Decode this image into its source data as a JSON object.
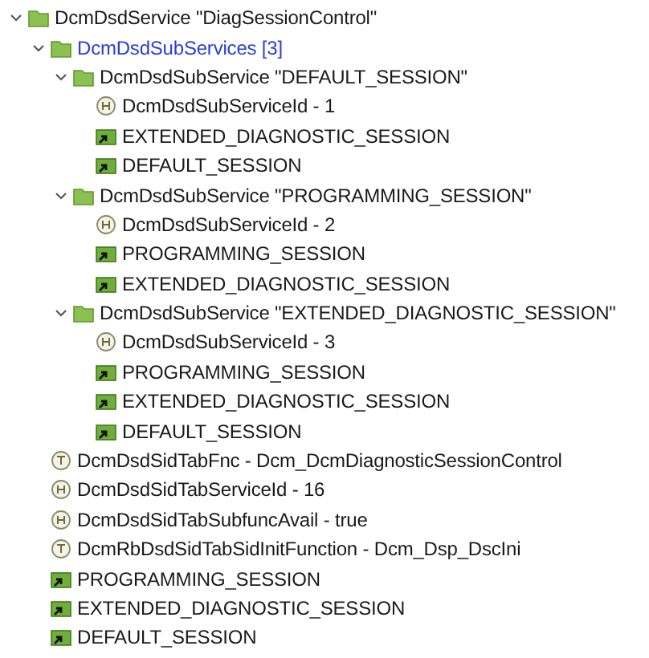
{
  "tree": [
    {
      "kind": "folder",
      "label": "DcmDsdService \"DiagSessionControl\"",
      "expanded": true,
      "children": [
        {
          "kind": "collection",
          "label": "DcmDsdSubServices [3]",
          "expanded": true,
          "children": [
            {
              "kind": "folder",
              "label": "DcmDsdSubService \"DEFAULT_SESSION\"",
              "expanded": true,
              "children": [
                {
                  "kind": "number",
                  "label": "DcmDsdSubServiceId - 1"
                },
                {
                  "kind": "reference",
                  "label": "EXTENDED_DIAGNOSTIC_SESSION"
                },
                {
                  "kind": "reference",
                  "label": "DEFAULT_SESSION"
                }
              ]
            },
            {
              "kind": "folder",
              "label": "DcmDsdSubService \"PROGRAMMING_SESSION\"",
              "expanded": true,
              "children": [
                {
                  "kind": "number",
                  "label": "DcmDsdSubServiceId - 2"
                },
                {
                  "kind": "reference",
                  "label": "PROGRAMMING_SESSION"
                },
                {
                  "kind": "reference",
                  "label": "EXTENDED_DIAGNOSTIC_SESSION"
                }
              ]
            },
            {
              "kind": "folder",
              "label": "DcmDsdSubService \"EXTENDED_DIAGNOSTIC_SESSION\"",
              "expanded": true,
              "children": [
                {
                  "kind": "number",
                  "label": "DcmDsdSubServiceId - 3"
                },
                {
                  "kind": "reference",
                  "label": "PROGRAMMING_SESSION"
                },
                {
                  "kind": "reference",
                  "label": "EXTENDED_DIAGNOSTIC_SESSION"
                },
                {
                  "kind": "reference",
                  "label": "DEFAULT_SESSION"
                }
              ]
            }
          ]
        },
        {
          "kind": "text",
          "label": "DcmDsdSidTabFnc - Dcm_DcmDiagnosticSessionControl"
        },
        {
          "kind": "number",
          "label": "DcmDsdSidTabServiceId - 16"
        },
        {
          "kind": "number",
          "label": "DcmDsdSidTabSubfuncAvail - true"
        },
        {
          "kind": "text",
          "label": "DcmRbDsdSidTabSidInitFunction - Dcm_Dsp_DscIni"
        },
        {
          "kind": "reference",
          "label": "PROGRAMMING_SESSION"
        },
        {
          "kind": "reference",
          "label": "EXTENDED_DIAGNOSTIC_SESSION"
        },
        {
          "kind": "reference",
          "label": "DEFAULT_SESSION"
        }
      ]
    }
  ]
}
